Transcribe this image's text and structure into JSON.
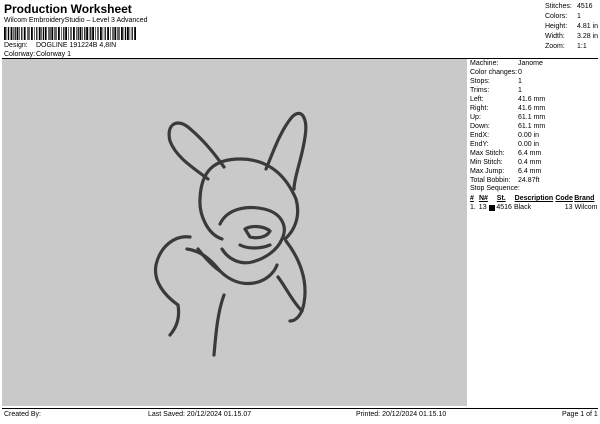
{
  "header": {
    "title": "Production Worksheet",
    "subtitle": "Wilcom EmbroideryStudio – Level 3 Advanced",
    "design_label": "Design:",
    "design_value": "DOGLINE 191224B 4,8IN",
    "colorway_label": "Colorway:",
    "colorway_value": "Colorway 1"
  },
  "stats": [
    {
      "label": "Stitches:",
      "value": "4516"
    },
    {
      "label": "Colors:",
      "value": "1"
    },
    {
      "label": "Height:",
      "value": "4.81 in"
    },
    {
      "label": "Width:",
      "value": "3.28 in"
    },
    {
      "label": "Zoom:",
      "value": "1:1"
    }
  ],
  "machine_info": [
    {
      "label": "Machine:",
      "value": "Janome"
    },
    {
      "label": "Color changes:",
      "value": "0"
    },
    {
      "label": "Stops:",
      "value": "1"
    },
    {
      "label": "Trims:",
      "value": "1"
    },
    {
      "label": "Left:",
      "value": "41.6 mm"
    },
    {
      "label": "Right:",
      "value": "41.6 mm"
    },
    {
      "label": "Up:",
      "value": "61.1 mm"
    },
    {
      "label": "Down:",
      "value": "61.1 mm"
    },
    {
      "label": "EndX:",
      "value": "0.00 in"
    },
    {
      "label": "EndY:",
      "value": "0.00 in"
    },
    {
      "label": "Max Stitch:",
      "value": "6.4 mm"
    },
    {
      "label": "Min Stitch:",
      "value": "0.4 mm"
    },
    {
      "label": "Max Jump:",
      "value": "6.4 mm"
    },
    {
      "label": "Total Bobbin:",
      "value": "24.87ft"
    }
  ],
  "stop_sequence": {
    "title": "Stop Sequence:",
    "headers": {
      "num": "#",
      "n": "N#",
      "st": "St.",
      "desc": "Description",
      "code": "Code",
      "brand": "Brand"
    },
    "rows": [
      {
        "num": "1.",
        "n": "13",
        "swatch_color": "#000000",
        "st": "4516",
        "desc": "Black",
        "code": "13",
        "brand": "Wilcom"
      }
    ]
  },
  "footer": {
    "created": "Created By:",
    "last_saved": "Last Saved: 20/12/2024 01.15.07",
    "printed": "Printed: 20/12/2024 01.15.10",
    "page": "Page 1 of 1"
  },
  "colors": {
    "design_bg": "#c9c9c9",
    "thread": "#3a3a3a"
  }
}
